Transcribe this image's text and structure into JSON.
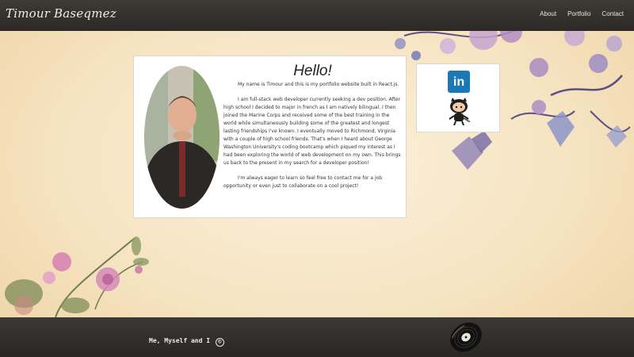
{
  "nav": {
    "brand": "Timour Baseqmez",
    "links": [
      {
        "label": "About"
      },
      {
        "label": "Portfolio"
      },
      {
        "label": "Contact"
      }
    ]
  },
  "about": {
    "heading": "Hello!",
    "paragraphs": [
      "My name is Timour and this is my portfolio website built in React.js.",
      "I am full-stack web developer currently seeking a dev position. After high school I decided to major in french as I am natively bilingual. I then joined the Marine Corps and received some of the best training in the world while simultaneously building some of the greatest and longest lasting friendships I've known. I eventually moved to Richmond, Virginia with a couple of high school friends. That's when I heard about George Washington University's coding bootcamp which piqued my interest as I had been exploring the world of web development on my own. This brings us back to the present in my search for a developer position!",
      "I'm always eager to learn so feel free to contact me for a job opportunity or even just to collaborate on a cool project!"
    ]
  },
  "social": {
    "linkedin_icon": "linkedin-icon",
    "linkedin_glyph": "in",
    "github_icon": "github-octocat-icon"
  },
  "footer": {
    "text": "Me, Myself and I",
    "copyright_glyph": "©",
    "record_icon": "vinyl-record-icon"
  },
  "colors": {
    "navbar": "#2f2c29",
    "background": "#f7e6c6",
    "linkedin": "#1a78b4"
  }
}
